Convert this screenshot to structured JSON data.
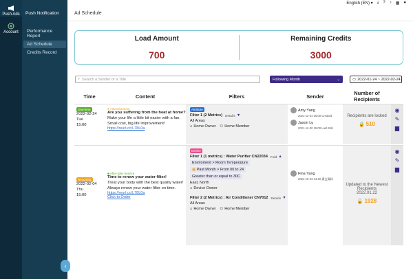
{
  "rail": [
    {
      "label": "Push Ads",
      "icon": "megaphone-icon",
      "active": true
    },
    {
      "label": "Account",
      "icon": "plus-circle-icon",
      "active": false
    }
  ],
  "subnav": {
    "header": "Push Notification",
    "items": [
      "Performance Report",
      "Ad Schedule",
      "Credits Record"
    ],
    "selected": "Ad Schedule"
  },
  "topbar": {
    "language": "English (EN)"
  },
  "page_title": "Ad Schedule",
  "stats": {
    "load_label": "Load Amount",
    "load_value": "700",
    "credits_label": "Remaining Credits",
    "credits_value": "3000"
  },
  "search": {
    "placeholder": "Search a Sender or a Title"
  },
  "filter_select": {
    "value": "Following Month"
  },
  "date_range": {
    "value": "2022-01-24 ~ 2022-02-24"
  },
  "columns": [
    "Time",
    "Content",
    "Filters",
    "Sender",
    "Number of Recipients"
  ],
  "rows": [
    {
      "badge": "One-time",
      "date": "2022-02-24",
      "day": "Tue",
      "time": "15:00",
      "content_tag": "Advertisement",
      "title": "Are you suffering from the heat at home?",
      "body": "Make your life a little bit easier with a fan. Small cost, big life improvement!",
      "link": "https://reurl.cc/L78L0a",
      "filter_badge": "Attribute",
      "filter1": "Filter 1 (2 Metrics)",
      "filter1_detail": "Details",
      "area": "All Areas",
      "target_a": "Home Owner",
      "target_b": "Home Member",
      "senders": [
        {
          "name": "Amy Yang",
          "date": "2021-12-24",
          "time": "15:00",
          "status": "Created"
        },
        {
          "name": "Jason Lu",
          "date": "2021-12-30",
          "time": "15:00",
          "status": "Last Edit"
        }
      ],
      "recip_text": "Recipients are locked",
      "recip_num": "510"
    },
    {
      "badge": "Recurring",
      "date": "2022-02-04",
      "day": "Thu",
      "time": "15:00",
      "content_tag": "After-sale Service",
      "title": "Time to renew your water filter!",
      "body": "Treat your body with the best quality water! Always renew your water filter on time.",
      "link": "https://reurl.cc/L78L0a",
      "link2": "Click to Order",
      "filter_badge": "Device",
      "filter1": "Filter 1 (1 metrics) : Water Purifier CN22034",
      "filter1_detail": "Fold",
      "metric1": "Enviroment > Room Temperature",
      "metric2": "Past Month > From 00 to 24",
      "metric3": "Greater than or equal to 30C",
      "area1": "East, North",
      "target1": "Device Owner",
      "filter2": "Filter 2 (2 Metrics) : Air Conditioner CN7012",
      "filter2_detail": "Details",
      "area2": "All Areas",
      "target_a": "Home Owner",
      "target_b": "Home Member",
      "senders": [
        {
          "name": "Fina Yang",
          "date": "2021-10-23",
          "time": "14:40",
          "status": "建立資料"
        }
      ],
      "recip_text": "Updated to the Newest Recipients",
      "recip_date": "2022.01.22",
      "recip_num": "1928"
    }
  ]
}
